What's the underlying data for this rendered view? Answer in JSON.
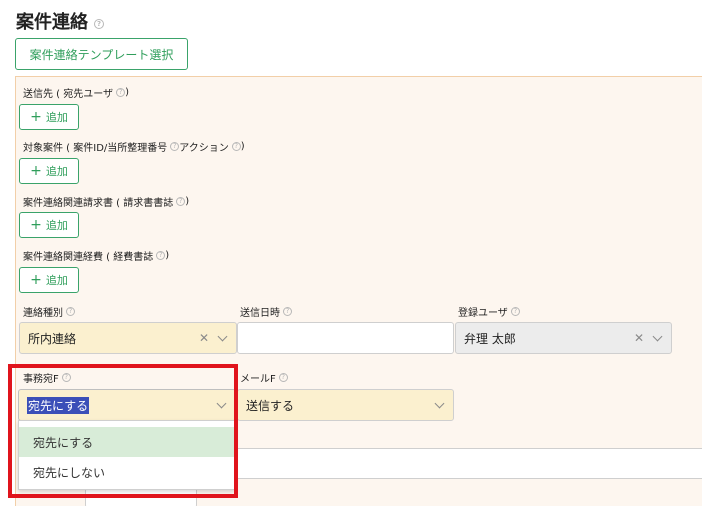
{
  "page": {
    "title": "案件連絡",
    "template_button": "案件連絡テンプレート選択"
  },
  "sections": [
    {
      "label_a": "送信先 ( 宛先ユーザ",
      "label_b": " )",
      "add": "追加"
    },
    {
      "label_a": "対象案件 ( 案件ID/当所整理番号",
      "label_mid": "アクション",
      "label_b": " )",
      "add": "追加"
    },
    {
      "label_a": "案件連絡関連請求書 ( 請求書書誌",
      "label_b": " )",
      "add": "追加"
    },
    {
      "label_a": "案件連絡関連経費 ( 経費書誌",
      "label_b": " )",
      "add": "追加"
    }
  ],
  "fields": {
    "contact_type": {
      "label": "連絡種別",
      "value": "所内連絡"
    },
    "send_datetime": {
      "label": "送信日時",
      "value": ""
    },
    "registered_user": {
      "label": "登録ユーザ",
      "value": "弁理 太郎"
    },
    "office_addr_flag": {
      "label": "事務宛F",
      "value": "宛先にする"
    },
    "mail_flag": {
      "label": "メールF",
      "value": "送信する"
    }
  },
  "dropdown": {
    "options": [
      "宛先にする",
      "宛先にしない"
    ]
  },
  "colors": {
    "accent_green": "#2f9e5b",
    "panel_bg": "#fdf6ef",
    "panel_border": "#f2cfa8",
    "highlight_red": "#e0141c",
    "select_yellow": "#fbf0cf",
    "option_hover": "#d8ecd8"
  }
}
